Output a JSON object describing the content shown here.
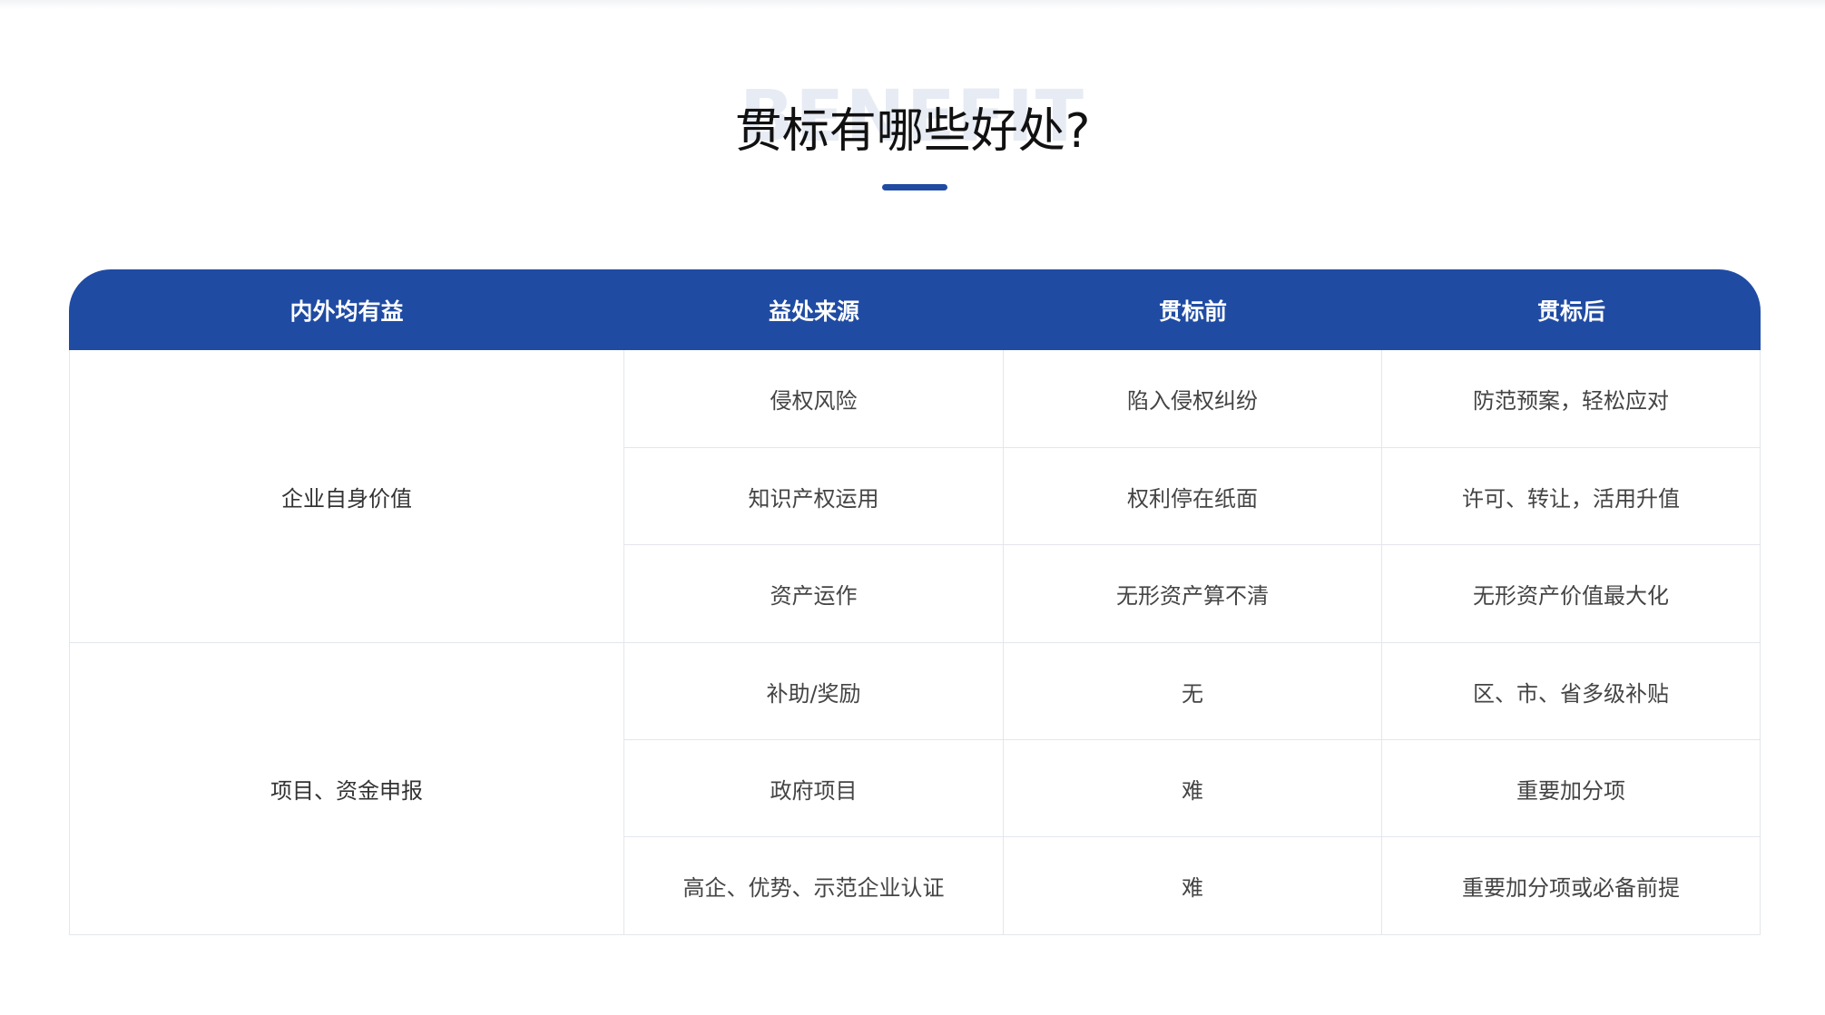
{
  "section": {
    "bg_word": "BENEFIT",
    "title": "贯标有哪些好处?"
  },
  "table": {
    "headers": [
      "内外均有益",
      "益处来源",
      "贯标前",
      "贯标后"
    ],
    "groups": [
      {
        "label": "企业自身价值",
        "rows": [
          [
            "侵权风险",
            "陷入侵权纠纷",
            "防范预案，轻松应对"
          ],
          [
            "知识产权运用",
            "权利停在纸面",
            "许可、转让，活用升值"
          ],
          [
            "资产运作",
            "无形资产算不清",
            "无形资产价值最大化"
          ]
        ]
      },
      {
        "label": "项目、资金申报",
        "rows": [
          [
            "补助/奖励",
            "无",
            "区、市、省多级补贴"
          ],
          [
            "政府项目",
            "难",
            "重要加分项"
          ],
          [
            "高企、优势、示范企业认证",
            "难",
            "重要加分项或必备前提"
          ]
        ]
      }
    ]
  },
  "colors": {
    "header_bg": "#1f4ba3",
    "accent_bar": "#1f4ba3",
    "border": "#e3e6ec"
  }
}
